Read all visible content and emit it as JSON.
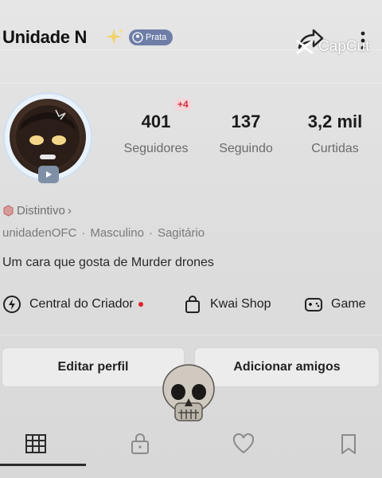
{
  "header": {
    "username": "Unidade N",
    "badge_label": "Prata",
    "watermark": "CapCut"
  },
  "stats": [
    {
      "value": "401",
      "label": "Seguidores",
      "delta": "+4"
    },
    {
      "value": "137",
      "label": "Seguindo"
    },
    {
      "value": "3,2 mil",
      "label": "Curtidas"
    }
  ],
  "profile": {
    "distintivo_label": "Distintivo",
    "meta": [
      "unidadenOFC",
      "Masculino",
      "Sagitário"
    ],
    "bio": "Um cara que gosta de Murder drones"
  },
  "shortcuts": [
    {
      "label": "Central do Criador",
      "icon": "lightning-icon"
    },
    {
      "label": "Kwai Shop",
      "icon": "shopping-bag-icon"
    },
    {
      "label": "Game",
      "icon": "gamepad-icon"
    }
  ],
  "actions": {
    "edit": "Editar perfil",
    "add_friends": "Adicionar amigos"
  },
  "tabs": [
    "grid-icon",
    "lock-icon",
    "heart-icon",
    "bookmark-icon"
  ],
  "colors": {
    "accent_red": "#e0212f",
    "badge_blue": "#6f7ea8"
  }
}
